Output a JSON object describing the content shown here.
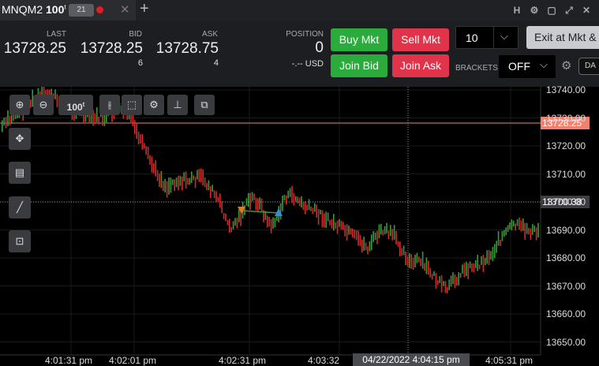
{
  "tab": {
    "symbol": "MNQM2",
    "size": "100",
    "size_sup": "t",
    "badge": "21",
    "close_glyph": "✕",
    "add_glyph": "+"
  },
  "window_icons": [
    {
      "name": "h-icon",
      "glyph": "H"
    },
    {
      "name": "gear-icon",
      "glyph": "⚙"
    },
    {
      "name": "restore-icon",
      "glyph": "▢"
    },
    {
      "name": "maximize-icon",
      "glyph": "⤢"
    },
    {
      "name": "close-icon",
      "glyph": "✕"
    }
  ],
  "quote": {
    "last_label": "LAST",
    "last": "13728.25",
    "bid_label": "BID",
    "bid": "13728.25",
    "bid_size": "6",
    "ask_label": "ASK",
    "ask": "13728.75",
    "ask_size": "4",
    "position_label": "POSITION",
    "position": "0",
    "pnl": "-.-- USD"
  },
  "buttons": {
    "buy_mkt": "Buy Mkt",
    "sell_mkt": "Sell Mkt",
    "join_bid": "Join Bid",
    "join_ask": "Join Ask",
    "exit": "Exit at Mkt &",
    "brackets_label": "BRACKETS",
    "brackets_value": "OFF",
    "da": "DA"
  },
  "quantity": "10",
  "chart_toolbar": {
    "zoom_in": "zoom-in-icon",
    "zoom_out": "zoom-out-icon",
    "bar_size": "100",
    "bar_size_sup": "t"
  },
  "chart": {
    "last_price_tag": "13728.25",
    "crosshair_price_tag": "13700.38",
    "crosshair_time_tag": "04/22/2022 4:04:15 pm",
    "price_labels": [
      "13740.00",
      "13730.00",
      "13720.00",
      "13710.00",
      "13700.00",
      "13690.00",
      "13680.00",
      "13670.00",
      "13660.00",
      "13650.00"
    ],
    "time_labels": [
      "4:01:31 pm",
      "4:02:01 pm",
      "4:02:31 pm",
      "4:03:32",
      "4:05:31 pm"
    ],
    "colors": {
      "up": "#3a9a3a",
      "down": "#d12b2b",
      "last_line": "#f08070"
    }
  }
}
